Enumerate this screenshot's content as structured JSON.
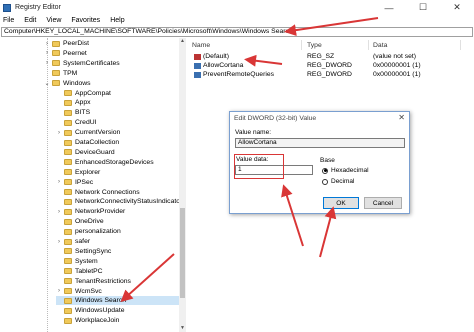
{
  "window": {
    "title": "Registry Editor",
    "controls": {
      "minimize": "—",
      "maximize": "☐",
      "close": "✕"
    }
  },
  "menu": [
    "File",
    "Edit",
    "View",
    "Favorites",
    "Help"
  ],
  "address": "Computer\\HKEY_LOCAL_MACHINE\\SOFTWARE\\Policies\\Microsoft\\Windows\\Windows Search",
  "tree": {
    "items": [
      {
        "label": "PeerDist",
        "expander": "›",
        "depth": 1
      },
      {
        "label": "Peernet",
        "expander": "›",
        "depth": 1
      },
      {
        "label": "SystemCertificates",
        "expander": "›",
        "depth": 1
      },
      {
        "label": "TPM",
        "expander": "",
        "depth": 1
      },
      {
        "label": "Windows",
        "expander": "⌄",
        "depth": 1
      },
      {
        "label": "AppCompat",
        "expander": "",
        "depth": 2
      },
      {
        "label": "Appx",
        "expander": "",
        "depth": 2
      },
      {
        "label": "BITS",
        "expander": "",
        "depth": 2
      },
      {
        "label": "CredUI",
        "expander": "",
        "depth": 2
      },
      {
        "label": "CurrentVersion",
        "expander": "›",
        "depth": 2
      },
      {
        "label": "DataCollection",
        "expander": "",
        "depth": 2
      },
      {
        "label": "DeviceGuard",
        "expander": "",
        "depth": 2
      },
      {
        "label": "EnhancedStorageDevices",
        "expander": "",
        "depth": 2
      },
      {
        "label": "Explorer",
        "expander": "",
        "depth": 2
      },
      {
        "label": "IPSec",
        "expander": "›",
        "depth": 2
      },
      {
        "label": "Network Connections",
        "expander": "",
        "depth": 2
      },
      {
        "label": "NetworkConnectivityStatusIndicator",
        "expander": "",
        "depth": 2
      },
      {
        "label": "NetworkProvider",
        "expander": "›",
        "depth": 2
      },
      {
        "label": "OneDrive",
        "expander": "",
        "depth": 2
      },
      {
        "label": "personalization",
        "expander": "",
        "depth": 2
      },
      {
        "label": "safer",
        "expander": "›",
        "depth": 2
      },
      {
        "label": "SettingSync",
        "expander": "",
        "depth": 2
      },
      {
        "label": "System",
        "expander": "",
        "depth": 2
      },
      {
        "label": "TabletPC",
        "expander": "",
        "depth": 2
      },
      {
        "label": "TenantRestrictions",
        "expander": "",
        "depth": 2
      },
      {
        "label": "WcmSvc",
        "expander": "›",
        "depth": 2
      },
      {
        "label": "Windows Search",
        "expander": "",
        "depth": 2,
        "selected": true
      },
      {
        "label": "WindowsUpdate",
        "expander": "",
        "depth": 2
      },
      {
        "label": "WorkplaceJoin",
        "expander": "",
        "depth": 2
      }
    ]
  },
  "list": {
    "headers": [
      "Name",
      "Type",
      "Data"
    ],
    "rows": [
      {
        "icon": "ab",
        "name": "(Default)",
        "type": "REG_SZ",
        "data": "(value not set)"
      },
      {
        "icon": "bin",
        "name": "AllowCortana",
        "type": "REG_DWORD",
        "data": "0x00000001 (1)"
      },
      {
        "icon": "bin",
        "name": "PreventRemoteQueries",
        "type": "REG_DWORD",
        "data": "0x00000001 (1)"
      }
    ]
  },
  "dialog": {
    "title": "Edit DWORD (32-bit) Value",
    "close": "✕",
    "value_name_label": "Value name:",
    "value_name": "AllowCortana",
    "value_data_label": "Value data:",
    "value_data": "1",
    "base_label": "Base",
    "base_options": [
      {
        "label": "Hexadecimal",
        "checked": true
      },
      {
        "label": "Decimal",
        "checked": false
      }
    ],
    "ok_label": "OK",
    "cancel_label": "Cancel"
  },
  "colors": {
    "annotation": "#d93636",
    "selection": "#cce4f7",
    "folder": "#f0c95a"
  }
}
